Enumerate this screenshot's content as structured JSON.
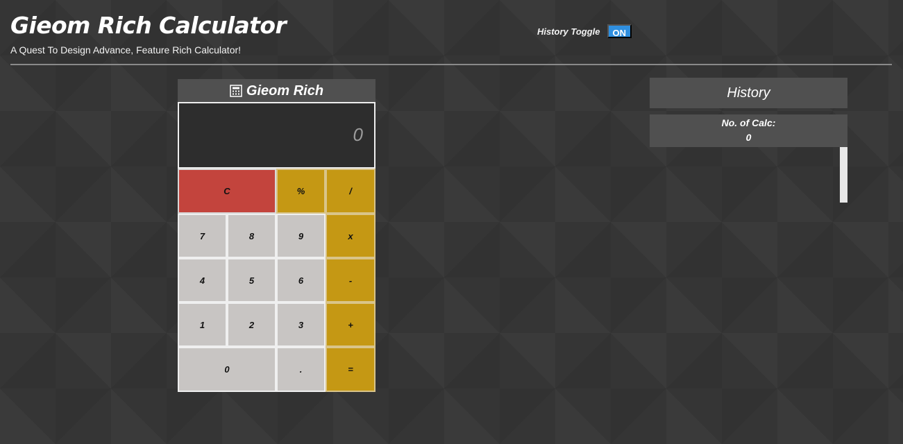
{
  "header": {
    "title": "Gieom Rich Calculator",
    "subtitle": "A Quest To Design Advance, Feature Rich Calculator!",
    "history_toggle_label": "History Toggle",
    "history_toggle_state": "ON"
  },
  "calculator": {
    "title": "Gieom Rich",
    "icon": "calculator-icon",
    "display_value": "0",
    "keys": {
      "clear": "C",
      "percent": "%",
      "divide": "/",
      "seven": "7",
      "eight": "8",
      "nine": "9",
      "multiply": "x",
      "four": "4",
      "five": "5",
      "six": "6",
      "minus": "-",
      "one": "1",
      "two": "2",
      "three": "3",
      "plus": "+",
      "zero": "0",
      "decimal": ".",
      "equals": "="
    }
  },
  "history": {
    "title": "History",
    "count_label": "No. of Calc:",
    "count_value": "0"
  },
  "colors": {
    "background": "#353535",
    "panel": "#505050",
    "clear_key": "#c3443d",
    "operator_key": "#c59814",
    "number_key": "#c8c5c3",
    "toggle_on": "#2f8fe0"
  }
}
